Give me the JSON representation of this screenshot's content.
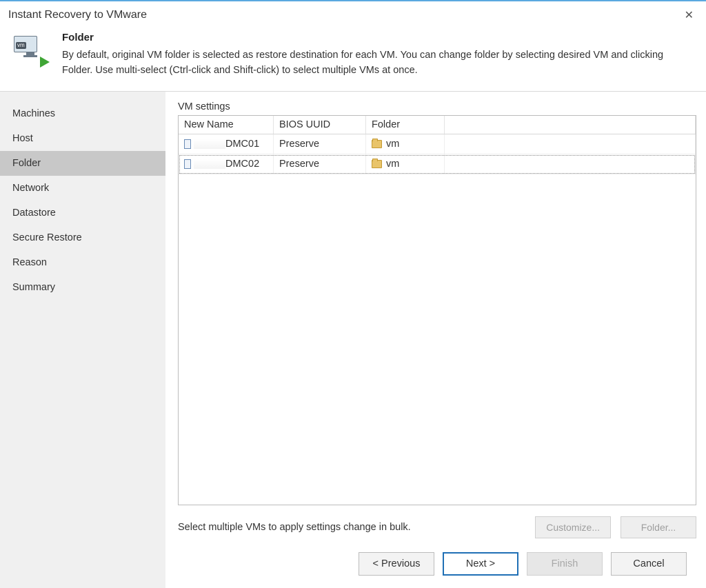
{
  "window": {
    "title": "Instant Recovery to VMware"
  },
  "header": {
    "heading": "Folder",
    "description": "By default, original VM folder is selected as restore destination for each VM. You can change folder by selecting desired VM and clicking Folder. Use multi-select (Ctrl-click and Shift-click) to select multiple VMs at once."
  },
  "sidebar": {
    "items": [
      {
        "label": "Machines"
      },
      {
        "label": "Host"
      },
      {
        "label": "Folder"
      },
      {
        "label": "Network"
      },
      {
        "label": "Datastore"
      },
      {
        "label": "Secure Restore"
      },
      {
        "label": "Reason"
      },
      {
        "label": "Summary"
      }
    ],
    "active_index": 2
  },
  "main": {
    "section_label": "VM settings",
    "columns": {
      "name": "New Name",
      "uuid": "BIOS UUID",
      "folder": "Folder"
    },
    "rows": [
      {
        "name_suffix": "DMC01",
        "uuid": "Preserve",
        "folder": "vm"
      },
      {
        "name_suffix": "DMC02",
        "uuid": "Preserve",
        "folder": "vm"
      }
    ],
    "hint": "Select multiple VMs to apply settings change in bulk.",
    "buttons": {
      "customize": "Customize...",
      "folder": "Folder..."
    }
  },
  "footer": {
    "previous": "< Previous",
    "next": "Next >",
    "finish": "Finish",
    "cancel": "Cancel"
  }
}
